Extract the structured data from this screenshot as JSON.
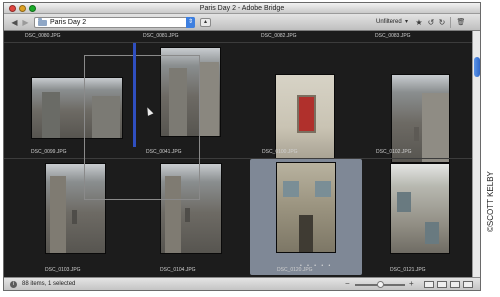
{
  "window": {
    "title": "Paris Day 2 - Adobe Bridge"
  },
  "toolbar": {
    "folder": "Paris Day 2",
    "filter": "Unfiltered",
    "icons": [
      "back-icon",
      "forward-icon",
      "folder-up-icon",
      "star-icon",
      "rotate-left-icon",
      "rotate-right-icon",
      "trash-icon"
    ]
  },
  "thumbnails": {
    "top_captions": [
      "DSC_0080.JPG",
      "DSC_0081.JPG",
      "DSC_0082.JPG",
      "DSC_0083.JPG"
    ],
    "row1": [
      "DSC_0099.JPG",
      "DSC_0041.JPG",
      "DSC_0100.JPG",
      "DSC_0102.JPG"
    ],
    "row2": [
      "DSC_0103.JPG",
      "DSC_0104.JPG",
      "DSC_0120.JPG",
      "DSC_0121.JPG"
    ],
    "selected": "DSC_0120.JPG"
  },
  "status": {
    "text": "88 items, 1 selected",
    "zoom_level": 0.5
  },
  "credit": "©SCOTT KELBY",
  "colors": {
    "content_bg": "#1c1c1c",
    "selection": "#7f8896",
    "insertion_marker": "#2f4fc0",
    "scroll_thumb": "#3d7fe0"
  }
}
